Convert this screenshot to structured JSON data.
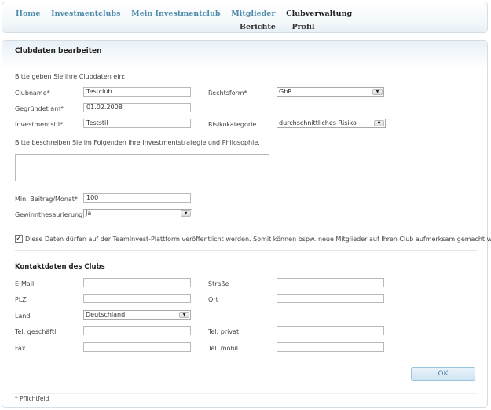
{
  "nav": {
    "primary": [
      "Home",
      "Investmentclubs",
      "Mein Investmentclub",
      "Mitglieder",
      "Clubverwaltung"
    ],
    "secondary": [
      "Berichte",
      "Profil"
    ]
  },
  "panel": {
    "title": "Clubdaten bearbeiten",
    "intro": "Bitte geben Sie ihre Clubdaten ein:"
  },
  "clubform": {
    "clubname_label": "Clubname*",
    "clubname_value": "Testclub",
    "rechtsform_label": "Rechtsform*",
    "rechtsform_value": "GbR",
    "gegruendet_label": "Gegründet am*",
    "gegruendet_value": "01.02.2008",
    "investmentstil_label": "Investmentstil*",
    "investmentstil_value": "Teststil",
    "risiko_label": "Risikokategorie",
    "risiko_value": "durchschnittliches Risiko",
    "strategie_text": "Bitte beschreiben Sie im Folgenden ihre Investmentstrategie und Philosophie.",
    "strategie_value": "",
    "beitrag_label": "Min. Beitrag/Monat*",
    "beitrag_value": "100",
    "thesaurierung_label": "Gewinnthesaurierung*",
    "thesaurierung_value": "Ja",
    "publish_text": "Diese Daten dürfen auf der TeamInvest-Plattform veröffentlicht werden. Somit können bspw. neue Mitglieder auf Ihren Club aufmerksam gemacht werden."
  },
  "contact": {
    "title": "Kontaktdaten des Clubs",
    "email_label": "E-Mail",
    "strasse_label": "Straße",
    "plz_label": "PLZ",
    "ort_label": "Ort",
    "land_label": "Land",
    "land_value": "Deutschland",
    "tel_geschaeft_label": "Tel. geschäftl.",
    "tel_privat_label": "Tel. privat",
    "fax_label": "Fax",
    "tel_mobil_label": "Tel. mobil"
  },
  "ok_label": "OK",
  "footnote": "* Pflichtfeld"
}
